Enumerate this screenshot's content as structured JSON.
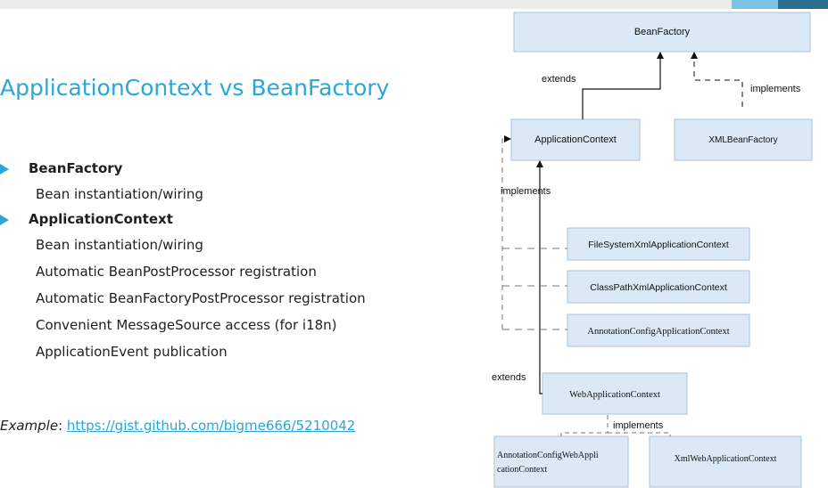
{
  "slide": {
    "title": "ApplicationContext vs BeanFactory",
    "bullets": [
      {
        "heading": "BeanFactory",
        "items": [
          "Bean instantiation/wiring"
        ]
      },
      {
        "heading": "ApplicationContext",
        "items": [
          "Bean instantiation/wiring",
          "Automatic BeanPostProcessor registration",
          "Automatic BeanFactoryPostProcessor registration",
          "Convenient MessageSource access (for i18n)",
          "ApplicationEvent publication"
        ]
      }
    ],
    "example": {
      "label": "Example",
      "separator": ": ",
      "link": "https://gist.github.com/bigme666/5210042"
    }
  },
  "diagram": {
    "boxes": {
      "bean_factory": "BeanFactory",
      "application_context": "ApplicationContext",
      "xml_bean_factory": "XMLBeanFactory",
      "file_system_xml": "FileSystemXmlApplicationContext",
      "class_path_xml": "ClassPathXmlApplicationContext",
      "annotation_config": "AnnotationConfigApplicationContext",
      "web_application_context": "WebApplicationContext",
      "annotation_config_web_1": "AnnotationConfigWebAppli",
      "annotation_config_web_2": "cationContext",
      "xml_web_application_context": "XmlWebApplicationContext"
    },
    "labels": {
      "extends_top": "extends",
      "implements_top": "implements",
      "implements_left": "implements",
      "extends_bottom": "extends",
      "implements_bottom": "implements"
    }
  },
  "colors": {
    "title_blue": "#2aa6d8",
    "box_fill": "#dbe9f6",
    "box_stroke": "#a9c3da",
    "accent_light": "#7cc3e3",
    "accent_dark": "#2b6f8e"
  }
}
